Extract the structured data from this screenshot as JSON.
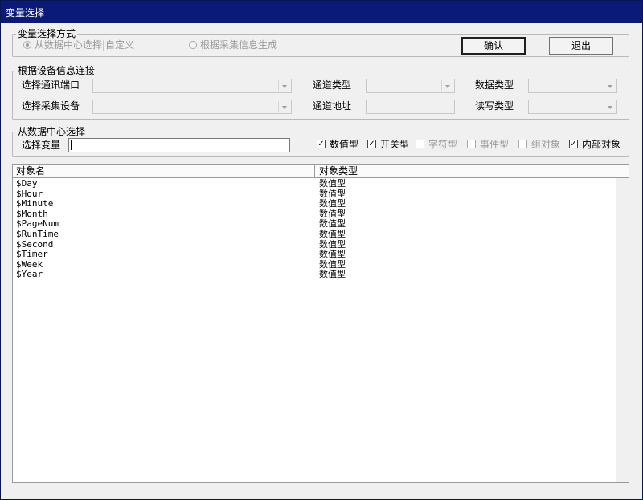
{
  "window": {
    "title": "变量选择"
  },
  "mode_group": {
    "legend": "变量选择方式",
    "option1": "从数据中心选择|自定义",
    "option2": "根据采集信息生成",
    "selected": "option1"
  },
  "buttons": {
    "confirm": "确认",
    "exit": "退出"
  },
  "device_group": {
    "legend": "根据设备信息连接",
    "port_label": "选择通讯端口",
    "device_label": "选择采集设备",
    "channel_type_label": "通道类型",
    "channel_addr_label": "通道地址",
    "data_type_label": "数据类型",
    "rw_type_label": "读写类型"
  },
  "center_group": {
    "legend": "从数据中心选择",
    "var_label": "选择变量",
    "var_value": "",
    "filters": [
      {
        "label": "数值型",
        "checked": true,
        "enabled": true
      },
      {
        "label": "开关型",
        "checked": true,
        "enabled": true
      },
      {
        "label": "字符型",
        "checked": false,
        "enabled": false
      },
      {
        "label": "事件型",
        "checked": false,
        "enabled": false
      },
      {
        "label": "组对象",
        "checked": false,
        "enabled": false
      },
      {
        "label": "内部对象",
        "checked": true,
        "enabled": true
      }
    ]
  },
  "table": {
    "columns": [
      "对象名",
      "对象类型"
    ],
    "rows": [
      [
        "$Day",
        "数值型"
      ],
      [
        "$Hour",
        "数值型"
      ],
      [
        "$Minute",
        "数值型"
      ],
      [
        "$Month",
        "数值型"
      ],
      [
        "$PageNum",
        "数值型"
      ],
      [
        "$RunTime",
        "数值型"
      ],
      [
        "$Second",
        "数值型"
      ],
      [
        "$Timer",
        "数值型"
      ],
      [
        "$Week",
        "数值型"
      ],
      [
        "$Year",
        "数值型"
      ]
    ]
  }
}
